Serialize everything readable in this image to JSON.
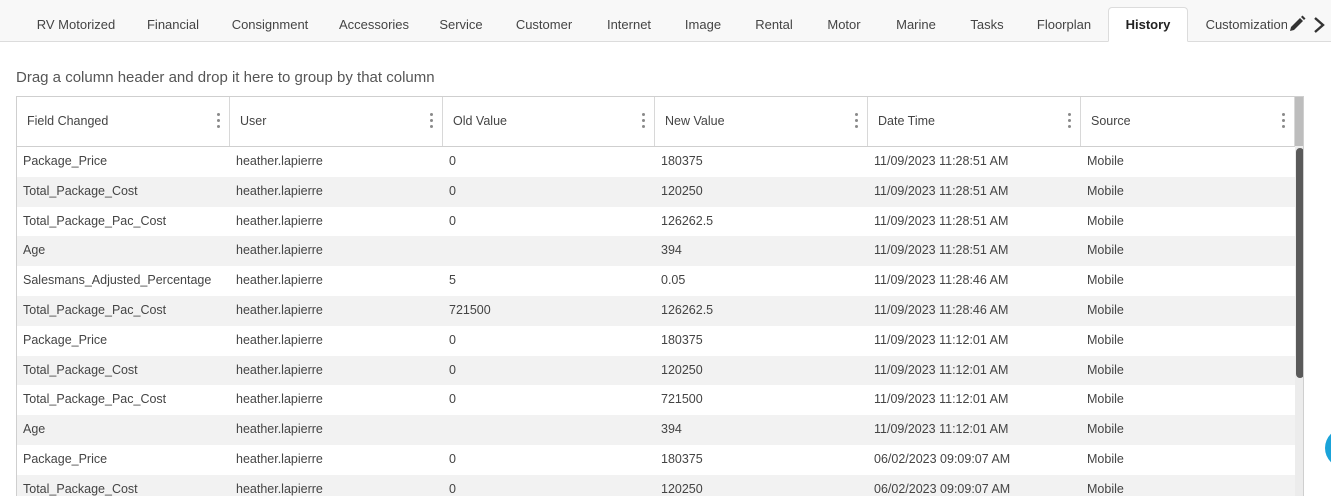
{
  "tabs": [
    {
      "label": "RV Motorized"
    },
    {
      "label": "Financial"
    },
    {
      "label": "Consignment"
    },
    {
      "label": "Accessories"
    },
    {
      "label": "Service"
    },
    {
      "label": "Customer"
    },
    {
      "label": "Internet"
    },
    {
      "label": "Image"
    },
    {
      "label": "Rental"
    },
    {
      "label": "Motor"
    },
    {
      "label": "Marine"
    },
    {
      "label": "Tasks"
    },
    {
      "label": "Floorplan"
    },
    {
      "label": "History"
    },
    {
      "label": "Customizations"
    }
  ],
  "active_tab": "History",
  "group_hint": "Drag a column header and drop it here to group by that column",
  "columns": [
    "Field Changed",
    "User",
    "Old Value",
    "New Value",
    "Date Time",
    "Source"
  ],
  "rows": [
    [
      "Package_Price",
      "heather.lapierre",
      "0",
      "180375",
      "11/09/2023 11:28:51 AM",
      "Mobile"
    ],
    [
      "Total_Package_Cost",
      "heather.lapierre",
      "0",
      "120250",
      "11/09/2023 11:28:51 AM",
      "Mobile"
    ],
    [
      "Total_Package_Pac_Cost",
      "heather.lapierre",
      "0",
      "126262.5",
      "11/09/2023 11:28:51 AM",
      "Mobile"
    ],
    [
      "Age",
      "heather.lapierre",
      "",
      "394",
      "11/09/2023 11:28:51 AM",
      "Mobile"
    ],
    [
      "Salesmans_Adjusted_Percentage",
      "heather.lapierre",
      "5",
      "0.05",
      "11/09/2023 11:28:46 AM",
      "Mobile"
    ],
    [
      "Total_Package_Pac_Cost",
      "heather.lapierre",
      "721500",
      "126262.5",
      "11/09/2023 11:28:46 AM",
      "Mobile"
    ],
    [
      "Package_Price",
      "heather.lapierre",
      "0",
      "180375",
      "11/09/2023 11:12:01 AM",
      "Mobile"
    ],
    [
      "Total_Package_Cost",
      "heather.lapierre",
      "0",
      "120250",
      "11/09/2023 11:12:01 AM",
      "Mobile"
    ],
    [
      "Total_Package_Pac_Cost",
      "heather.lapierre",
      "0",
      "721500",
      "11/09/2023 11:12:01 AM",
      "Mobile"
    ],
    [
      "Age",
      "heather.lapierre",
      "",
      "394",
      "11/09/2023 11:12:01 AM",
      "Mobile"
    ],
    [
      "Package_Price",
      "heather.lapierre",
      "0",
      "180375",
      "06/02/2023 09:09:07 AM",
      "Mobile"
    ],
    [
      "Total_Package_Cost",
      "heather.lapierre",
      "0",
      "120250",
      "06/02/2023 09:09:07 AM",
      "Mobile"
    ]
  ],
  "icons": {
    "edit": "pencil-icon",
    "next": "chevron-right-icon",
    "column_menu": "kebab-menu-icon"
  },
  "colors": {
    "accent_fab": "#1aa3d9",
    "alt_row": "#f2f2f2",
    "scroll_thumb": "#5a5a5a"
  }
}
